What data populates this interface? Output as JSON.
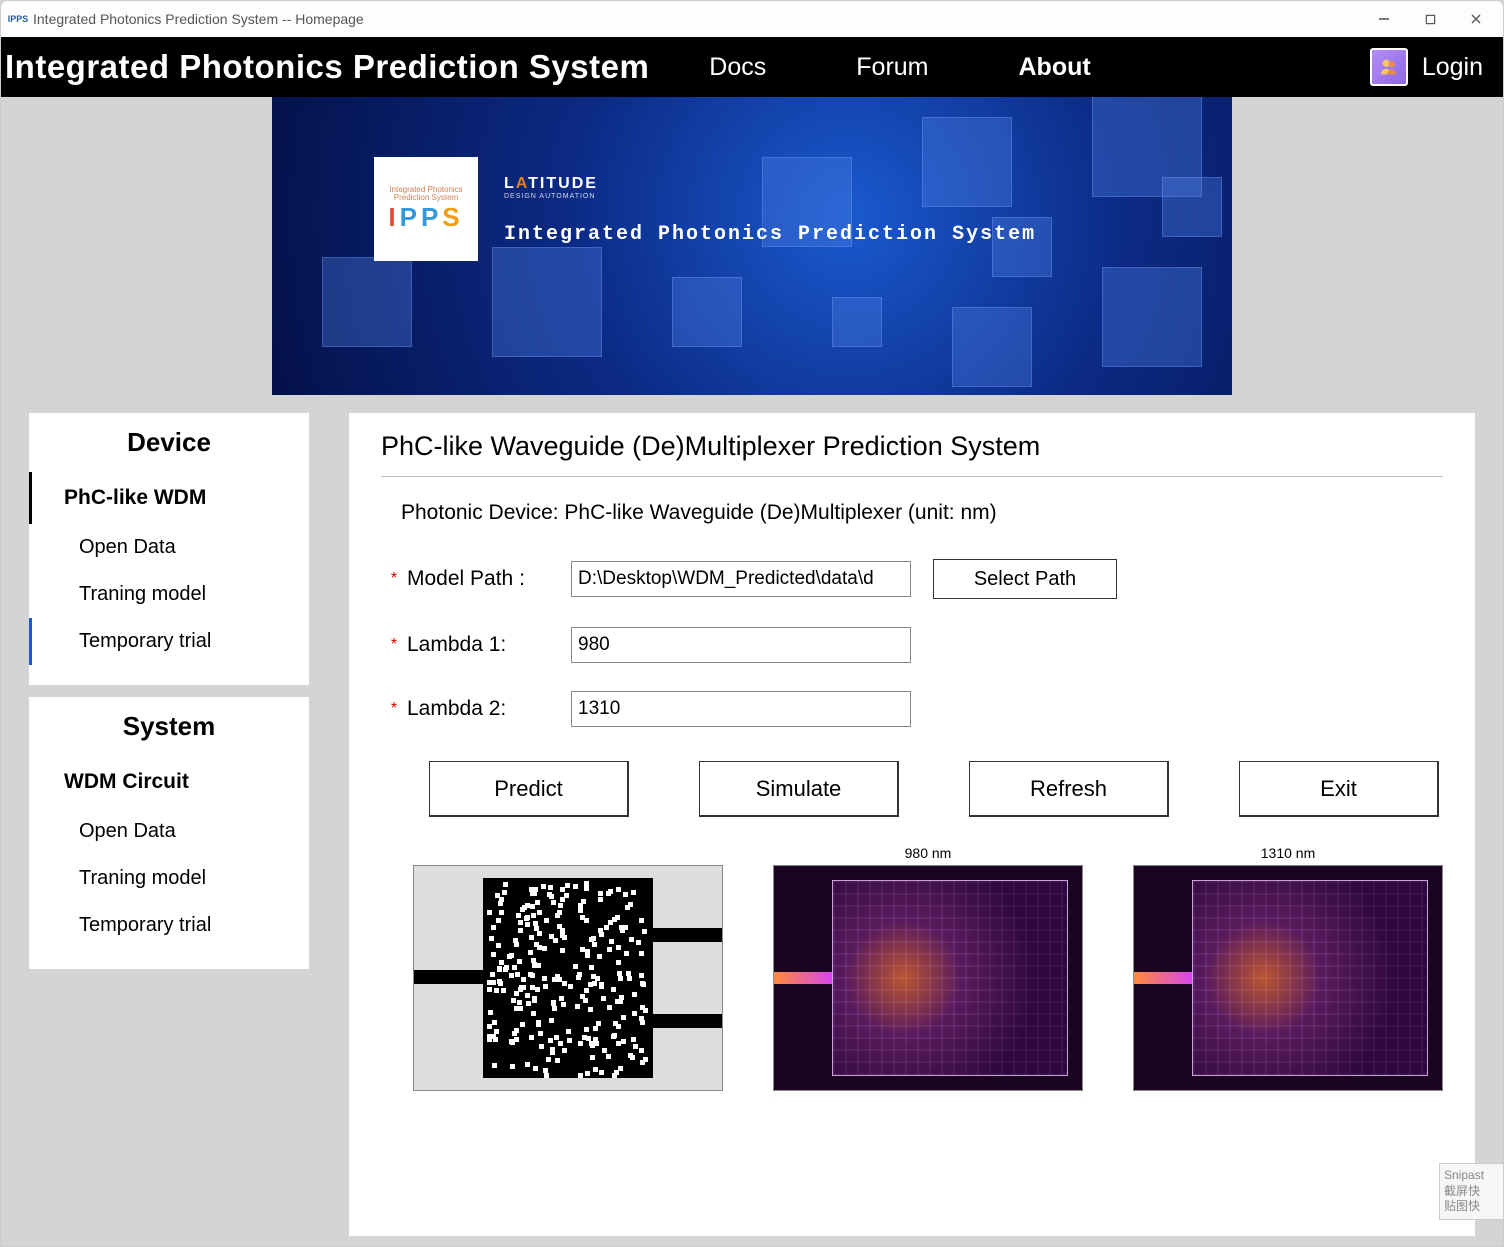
{
  "window": {
    "title": "Integrated Photonics Prediction System -- Homepage",
    "app_icon_label": "IPPS"
  },
  "nav": {
    "brand": "Integrated Photonics Prediction System",
    "links": [
      "Docs",
      "Forum",
      "About"
    ],
    "active_index": 2,
    "login": "Login"
  },
  "banner": {
    "ipps_small": "Integrated Photonics\nPrediction System",
    "latitude": "LATITUDE",
    "latitude_sub": "DESIGN AUTOMATION",
    "tagline": "Integrated Photonics Prediction System"
  },
  "sidebar": {
    "groups": [
      {
        "header": "Device",
        "section": "PhC-like WDM",
        "items": [
          "Open Data",
          "Traning model",
          "Temporary trial"
        ],
        "active_item_index": 2
      },
      {
        "header": "System",
        "section": "WDM Circuit",
        "items": [
          "Open Data",
          "Traning model",
          "Temporary trial"
        ],
        "active_item_index": -1
      }
    ]
  },
  "panel": {
    "title": "PhC-like Waveguide (De)Multiplexer Prediction System",
    "subtitle": "Photonic Device: PhC-like Waveguide (De)Multiplexer (unit: nm)",
    "fields": {
      "model_path": {
        "label": "Model Path :",
        "value": "D:\\Desktop\\WDM_Predicted\\data\\d",
        "button": "Select Path"
      },
      "lambda1": {
        "label": "Lambda 1:",
        "value": "980"
      },
      "lambda2": {
        "label": "Lambda 2:",
        "value": "1310"
      }
    },
    "actions": [
      "Predict",
      "Simulate",
      "Refresh",
      "Exit"
    ],
    "previews": {
      "structure_caption": "",
      "field1_caption": "980 nm",
      "field2_caption": "1310 nm"
    }
  },
  "overlay": {
    "line1": "Snipast",
    "line2": "截屏快",
    "line3": "贴图快"
  }
}
